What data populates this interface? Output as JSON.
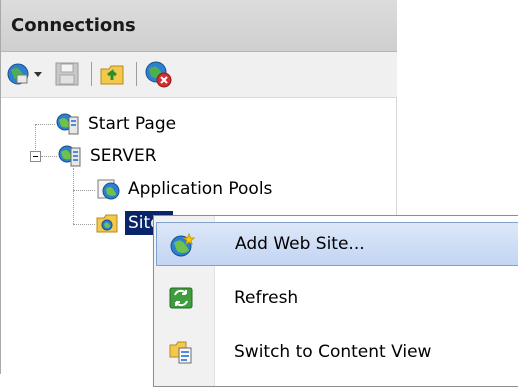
{
  "connections": {
    "title": "Connections",
    "toolbar": {
      "connect_icon": "globe-connect-icon",
      "save_icon": "save-icon",
      "up_icon": "folder-up-icon",
      "disconnect_icon": "disconnect-icon"
    },
    "tree": {
      "start_page": "Start Page",
      "server": "SERVER",
      "app_pools": "Application Pools",
      "sites": "Sites"
    }
  },
  "context_menu": {
    "items": [
      {
        "label": "Add Web Site...",
        "icon": "globe-add-icon"
      },
      {
        "label": "Refresh",
        "icon": "refresh-icon"
      },
      {
        "label": "Switch to Content View",
        "icon": "content-view-icon"
      }
    ]
  },
  "colors": {
    "selection": "#0a246a",
    "menu_hover": "#c2d5f3",
    "header": "#d4d4d4"
  }
}
